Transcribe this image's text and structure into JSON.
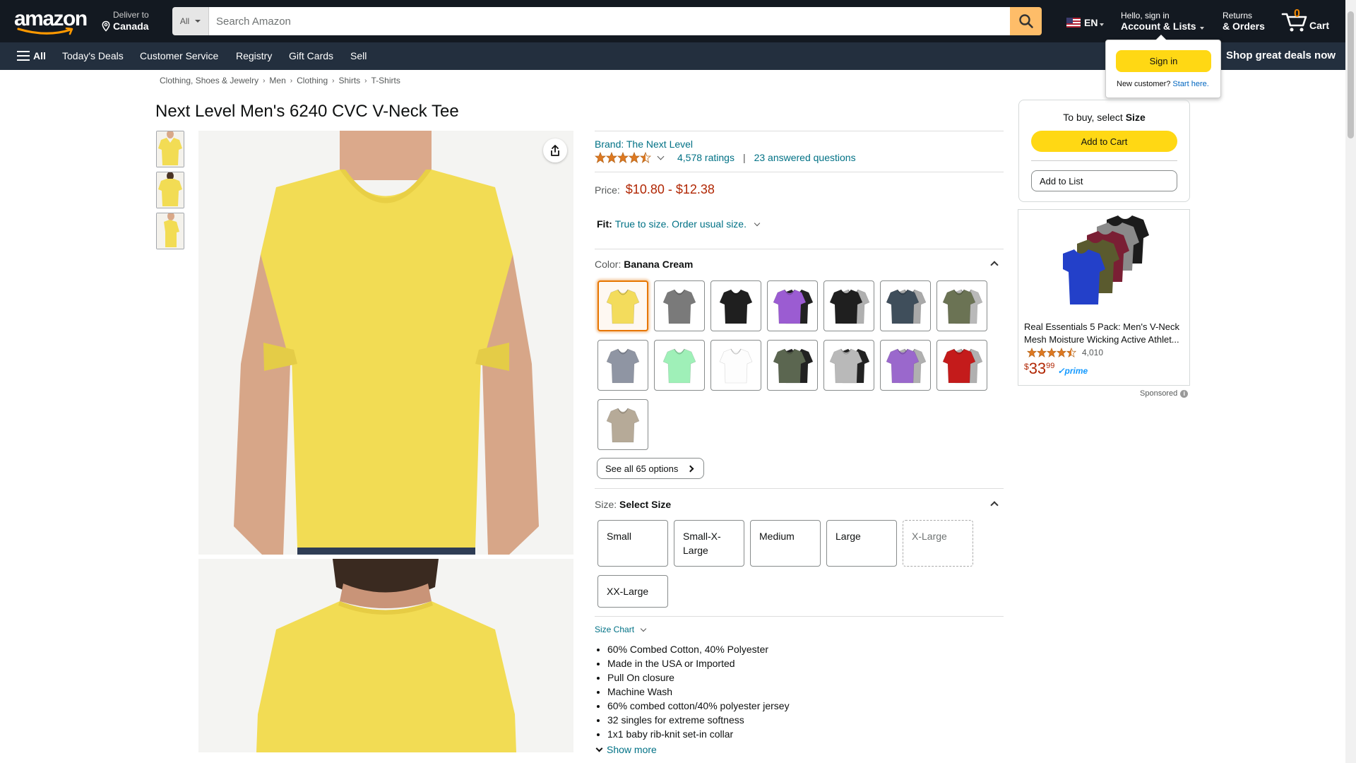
{
  "header": {
    "logo_text": "amazon",
    "deliver_to_label": "Deliver to",
    "deliver_to_location": "Canada",
    "search_category": "All",
    "search_placeholder": "Search Amazon",
    "language": "EN",
    "account_greeting": "Hello, sign in",
    "account_label": "Account & Lists",
    "returns_label": "Returns",
    "orders_label": "& Orders",
    "cart_count": "0",
    "cart_label": "Cart"
  },
  "subnav": {
    "all_label": "All",
    "items": [
      "Today's Deals",
      "Customer Service",
      "Registry",
      "Gift Cards",
      "Sell"
    ],
    "promo": "Shop great deals now"
  },
  "flyout": {
    "sign_in": "Sign in",
    "new_customer": "New customer?",
    "start_here": "Start here."
  },
  "breadcrumb": [
    "Clothing, Shoes & Jewelry",
    "Men",
    "Clothing",
    "Shirts",
    "T-Shirts"
  ],
  "product": {
    "title": "Next Level Men's 6240 CVC V-Neck Tee",
    "brand": "Brand: The Next Level",
    "rating_stars": 4.5,
    "ratings_count": "4,578 ratings",
    "answered_questions": "23 answered questions",
    "price_label": "Price:",
    "price_range": "$10.80 - $12.38",
    "fit_label": "Fit:",
    "fit_value": "True to size. Order usual size.",
    "color_label": "Color:",
    "color_selected": "Banana Cream",
    "color_swatches": [
      {
        "shirt": "#f3dc5c",
        "back": ""
      },
      {
        "shirt": "#7a7a7a",
        "back": ""
      },
      {
        "shirt": "#1f1f1f",
        "back": ""
      },
      {
        "shirt": "#9b5cd2",
        "back": "#222222"
      },
      {
        "shirt": "#1f1f1f",
        "back": "#b0b0b0"
      },
      {
        "shirt": "#3f4e5b",
        "back": "#a9a9a9"
      },
      {
        "shirt": "#6b7354",
        "back": "#b9b9b9"
      },
      {
        "shirt": "#8f95a3",
        "back": ""
      },
      {
        "shirt": "#9ff0b8",
        "back": ""
      },
      {
        "shirt": "#fdfdfd",
        "back": ""
      },
      {
        "shirt": "#5b6650",
        "back": "#222222"
      },
      {
        "shirt": "#b9b9b9",
        "back": "#222222"
      },
      {
        "shirt": "#9a68cc",
        "back": "#b0b0b0"
      },
      {
        "shirt": "#c41b1b",
        "back": "#b0b0b0"
      },
      {
        "shirt": "#b6aa98",
        "back": ""
      }
    ],
    "see_all_options": "See all 65 options",
    "size_label": "Size:",
    "size_selected": "Select Size",
    "sizes": [
      {
        "label": "Small",
        "available": true
      },
      {
        "label": "Small-X-Large",
        "available": true
      },
      {
        "label": "Medium",
        "available": true
      },
      {
        "label": "Large",
        "available": true
      },
      {
        "label": "X-Large",
        "available": false
      },
      {
        "label": "XX-Large",
        "available": true
      }
    ],
    "size_chart": "Size Chart",
    "bullets": [
      "60% Combed Cotton, 40% Polyester",
      "Made in the USA or Imported",
      "Pull On closure",
      "Machine Wash",
      "60% combed cotton/40% polyester jersey",
      "32 singles for extreme softness",
      "1x1 baby rib-knit set-in collar"
    ],
    "show_more": "Show more"
  },
  "buybox": {
    "to_buy": "To buy, select",
    "to_buy_bold": "Size",
    "add_to_cart": "Add to Cart",
    "add_to_list": "Add to List"
  },
  "ad": {
    "name_line1": "Real Essentials 5 Pack: Men's V-Neck",
    "name_line2": "Mesh Moisture Wicking Active Athlet...",
    "rating_stars": 4.5,
    "rating_count": "4,010",
    "price_symbol": "$",
    "price_whole": "33",
    "price_fraction": "99",
    "prime": "prime",
    "sponsored": "Sponsored"
  },
  "colors": {
    "nav_dark": "#131921",
    "nav_sub": "#232f3e",
    "accent_yellow": "#ffd814",
    "search_button": "#febd69",
    "price_red": "#b12704",
    "link_teal": "#007185",
    "selected_swatch": "#e77600",
    "product_yellow": "#f2dc54"
  }
}
